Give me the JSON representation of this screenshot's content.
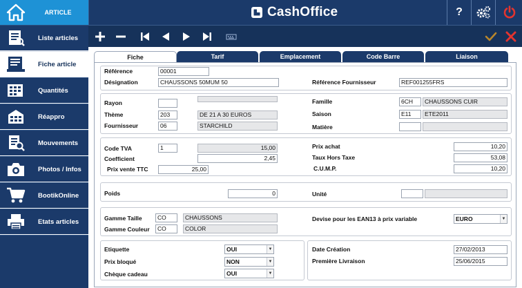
{
  "app": {
    "name": "CashOffice",
    "home_label": "ARTICLE",
    "help_label": "?"
  },
  "colors": {
    "sidebar_bg": "#1b3a6a",
    "home_blue": "#1e92d6",
    "power_red": "#e3342f",
    "accept": "#b8862b",
    "cancel": "#e3342f"
  },
  "sidebar": {
    "items": [
      {
        "label": "Liste articles",
        "icon": "list-icon"
      },
      {
        "label": "Fiche article",
        "icon": "card-icon",
        "active": true
      },
      {
        "label": "Quantités",
        "icon": "quantities-icon"
      },
      {
        "label": "Réappro",
        "icon": "restock-icon"
      },
      {
        "label": "Mouvements",
        "icon": "movements-icon"
      },
      {
        "label": "Photos / Infos",
        "icon": "camera-icon"
      },
      {
        "label": "BootikOnline",
        "icon": "cart-icon"
      },
      {
        "label": "Etats articles",
        "icon": "printer-icon"
      }
    ]
  },
  "tabs": [
    {
      "label": "Fiche",
      "active": true
    },
    {
      "label": "Tarif"
    },
    {
      "label": "Emplacement"
    },
    {
      "label": "Code Barre"
    },
    {
      "label": "Liaison"
    }
  ],
  "form": {
    "reference": {
      "label": "Référence",
      "value": "00001"
    },
    "designation": {
      "label": "Désignation",
      "value": "CHAUSSONS 50MUM 50"
    },
    "ref_fournisseur": {
      "label": "Référence Fournisseur",
      "value": "REF001255FRS"
    },
    "rayon": {
      "label": "Rayon",
      "code": "",
      "value": ""
    },
    "theme": {
      "label": "Thème",
      "code": "203",
      "value": "DE 21 A 30 EUROS"
    },
    "fournisseur": {
      "label": "Fournisseur",
      "code": "06",
      "value": "STARCHILD"
    },
    "famille": {
      "label": "Famille",
      "code": "6CH",
      "value": "CHAUSSONS CUIR"
    },
    "saison": {
      "label": "Saison",
      "code": "E11",
      "value": "ETE2011"
    },
    "matiere": {
      "label": "Matière",
      "code": "",
      "value": ""
    },
    "code_tva": {
      "label": "Code TVA",
      "code": "1",
      "value": "15,00"
    },
    "coefficient": {
      "label": "Coefficient",
      "value": "2,45"
    },
    "prix_vente_ttc": {
      "label": "Prix vente TTC",
      "value": "25,00"
    },
    "prix_achat": {
      "label": "Prix achat",
      "value": "10,20"
    },
    "taux_ht": {
      "label": "Taux Hors Taxe",
      "value": "53,08"
    },
    "cump": {
      "label": "C.U.M.P.",
      "value": "10,20"
    },
    "poids": {
      "label": "Poids",
      "value": "0"
    },
    "unite": {
      "label": "Unité",
      "code": "",
      "value": ""
    },
    "gamme_taille": {
      "label": "Gamme Taille",
      "code": "CO",
      "value": "CHAUSSONS"
    },
    "gamme_couleur": {
      "label": "Gamme Couleur",
      "code": "CO",
      "value": "COLOR"
    },
    "devise": {
      "label": "Devise pour les EAN13 à prix variable",
      "value": "EURO"
    },
    "etiquette": {
      "label": "Etiquette",
      "value": "OUI"
    },
    "prix_bloque": {
      "label": "Prix bloqué",
      "value": "NON"
    },
    "cheque_cadeau": {
      "label": "Chèque cadeau",
      "value": "OUI"
    },
    "date_creation": {
      "label": "Date Création",
      "value": "27/02/2013"
    },
    "premiere_livraison": {
      "label": "Première Livraison",
      "value": "25/06/2015"
    }
  }
}
